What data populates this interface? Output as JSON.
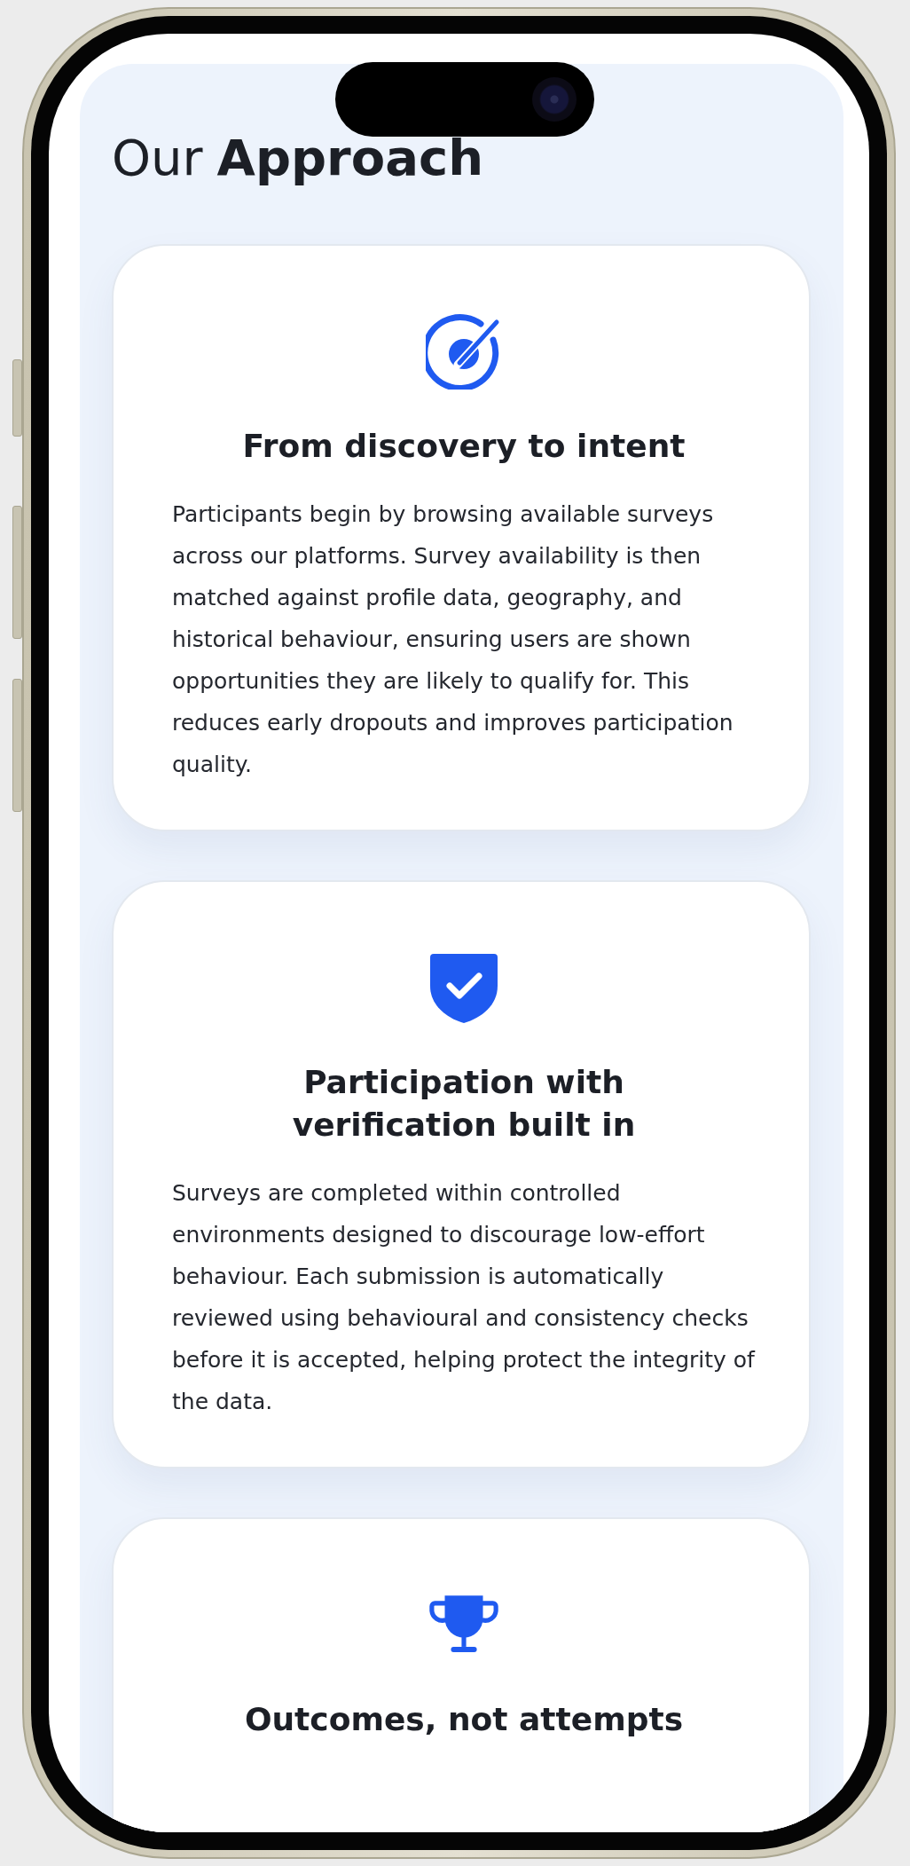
{
  "heading": {
    "light": "Our",
    "bold": "Approach"
  },
  "cards": [
    {
      "kind": "target",
      "title": "From discovery to intent",
      "body": "Participants begin by browsing available surveys across our platforms. Survey availability is then matched against profile data, geography, and historical behaviour, ensuring users are shown opportunities they are likely to qualify for. This reduces early dropouts and improves participation quality."
    },
    {
      "kind": "shield",
      "title": "Participation with verification built in",
      "body": "Surveys are completed within controlled environments designed to discourage low-effort behaviour. Each submission is automatically reviewed using behavioural and consistency checks before it is accepted, helping protect the integrity of the data."
    },
    {
      "kind": "trophy",
      "title": "Outcomes, not attempts"
    }
  ]
}
